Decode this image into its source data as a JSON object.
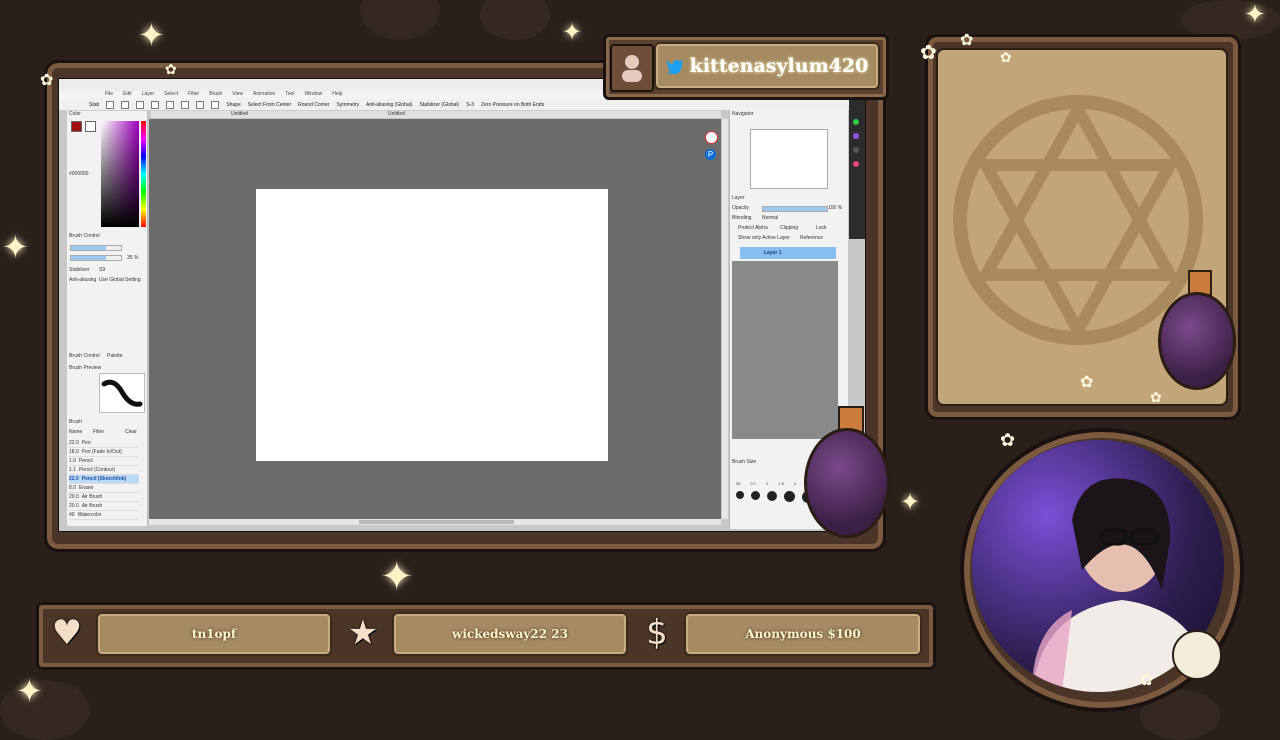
{
  "overlay": {
    "twitter_handle": "kittenasylum420",
    "latest_follower": "tn1opf",
    "latest_sub": "wickedsway22 23",
    "latest_donation": "Anonymous $100"
  },
  "icons": {
    "heart": "heart-icon",
    "star": "star-icon",
    "dollar": "dollar-icon",
    "twitter": "twitter-bird-icon",
    "avatar": "person-icon"
  },
  "colors": {
    "wood_dark": "#1a1210",
    "wood": "#4a3528",
    "wood_light": "#7b5a3f",
    "plaque": "#a58a62",
    "potion": "#5b2f6b",
    "text_glow": "#fff5cc"
  },
  "app": {
    "title": "",
    "menu": [
      "File",
      "Edit",
      "Layer",
      "Select",
      "Filter",
      "Brush",
      "View",
      "Animation",
      "Tool",
      "Window",
      "Help"
    ],
    "toolbar": {
      "stab_label": "Stab",
      "shape_label": "Shape",
      "select_from_center": "Select From Center",
      "round_corner": "Round Corner",
      "symmetry": "Symmetry",
      "anti_aliasing": "Anti-aliasing (Global)",
      "stabilizer": "Stabilizer (Global)",
      "stabilizer_value": "S-3",
      "zero_pressure": "Zero Pressure on Both Ends"
    },
    "tabs": [
      "Untitled",
      "Untitled"
    ],
    "left_panel": {
      "color_label": "Color",
      "hex_value": "#000000",
      "brush_control": "Brush Control",
      "size_value": "35 %",
      "stabilizer_label": "Stabilizer",
      "stabilizer_value": "S9",
      "anti_aliasing_label": "Anti-aliasing",
      "anti_aliasing_value": "Use Global Setting",
      "tab_brush_control": "Brush Control",
      "tab_palette": "Palette",
      "brush_preview": "Brush Preview",
      "brush_label": "Brush",
      "name_label": "Name",
      "filter_label": "Filter",
      "clear_label": "Clear",
      "brushes": [
        {
          "size": "22.0",
          "name": "Pen"
        },
        {
          "size": "18.0",
          "name": "Pen (Fade In/Out)"
        },
        {
          "size": "1.0",
          "name": "Pencil"
        },
        {
          "size": "1.1",
          "name": "Pencil (Contour)"
        },
        {
          "size": "22.0",
          "name": "Pencil (Sketch/Ink)"
        },
        {
          "size": "8.0",
          "name": "Eraser"
        },
        {
          "size": "20.0",
          "name": "Air Brush"
        },
        {
          "size": "20.0",
          "name": "Air Brush"
        },
        {
          "size": "40",
          "name": "Watercolor"
        }
      ],
      "selected_brush_index": 4
    },
    "right_panel": {
      "navigator": "Navigator",
      "layer": "Layer",
      "opacity_label": "Opacity",
      "opacity_value": "100 %",
      "blending_label": "Blending",
      "blending_value": "Normal",
      "protect_alpha": "Protect Alpha",
      "clipping": "Clipping",
      "lock": "Lock",
      "show_only_active": "Show only Active Layer",
      "reference": "Reference",
      "layer_name": "Layer 1",
      "brush_size_label": "Brush Size",
      "brush_sizes": [
        "25",
        "0.7",
        "1",
        "1.5",
        "2"
      ]
    }
  }
}
